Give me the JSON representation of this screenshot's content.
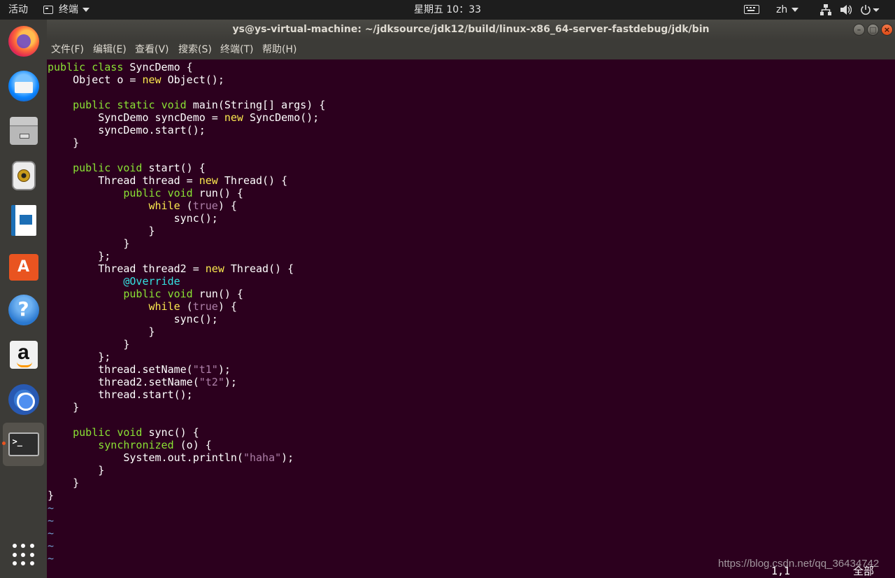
{
  "topbar": {
    "activities": "活动",
    "app_menu": "终端",
    "clock": "星期五 10：33",
    "language": "zh",
    "keyboard_icon": "keyboard-icon",
    "network_icon": "network-icon",
    "volume_icon": "volume-icon",
    "power_icon": "power-icon"
  },
  "dock": {
    "items": [
      {
        "name": "firefox",
        "icon": "firefox-icon"
      },
      {
        "name": "thunderbird",
        "icon": "thunderbird-icon"
      },
      {
        "name": "files",
        "icon": "files-icon"
      },
      {
        "name": "rhythmbox",
        "icon": "rhythmbox-icon"
      },
      {
        "name": "libreoffice-writer",
        "icon": "writer-icon"
      },
      {
        "name": "software",
        "icon": "software-store-icon"
      },
      {
        "name": "help",
        "icon": "help-icon"
      },
      {
        "name": "amazon",
        "icon": "amazon-icon"
      },
      {
        "name": "chromium",
        "icon": "chromium-icon"
      },
      {
        "name": "terminal",
        "icon": "terminal-icon",
        "active": true
      }
    ],
    "show_apps_icon": "app-grid-icon"
  },
  "window": {
    "title": "ys@ys-virtual-machine: ~/jdksource/jdk12/build/linux-x86_64-server-fastdebug/jdk/bin",
    "buttons": [
      "minimize",
      "maximize",
      "close"
    ],
    "menu": [
      "文件(F)",
      "编辑(E)",
      "查看(V)",
      "搜索(S)",
      "终端(T)",
      "帮助(H)"
    ]
  },
  "editor": {
    "lines": [
      "public class SyncDemo {",
      "    Object o = new Object();",
      "",
      "    public static void main(String[] args) {",
      "        SyncDemo syncDemo = new SyncDemo();",
      "        syncDemo.start();",
      "    }",
      "",
      "    public void start() {",
      "        Thread thread = new Thread() {",
      "            public void run() {",
      "                while (true) {",
      "                    sync();",
      "                }",
      "            }",
      "        };",
      "        Thread thread2 = new Thread() {",
      "            @Override",
      "            public void run() {",
      "                while (true) {",
      "                    sync();",
      "                }",
      "            }",
      "        };",
      "        thread.setName(\"t1\");",
      "        thread2.setName(\"t2\");",
      "        thread.start();",
      "    }",
      "",
      "    public void sync() {",
      "        synchronized (o) {",
      "            System.out.println(\"haha\");",
      "        }",
      "    }",
      "}"
    ],
    "empty_marker": "~",
    "empty_lines": 5,
    "cursor_position": "1,1",
    "scroll_status": "全部"
  },
  "watermark": "https://blog.csdn.net/qq_36434742",
  "colors": {
    "terminal_bg": "#2c001e",
    "keyword": "#fce94f",
    "type": "#8ae234",
    "string": "#ad7fa8",
    "annotation": "#34e2e2",
    "tilde": "#729fcf"
  }
}
